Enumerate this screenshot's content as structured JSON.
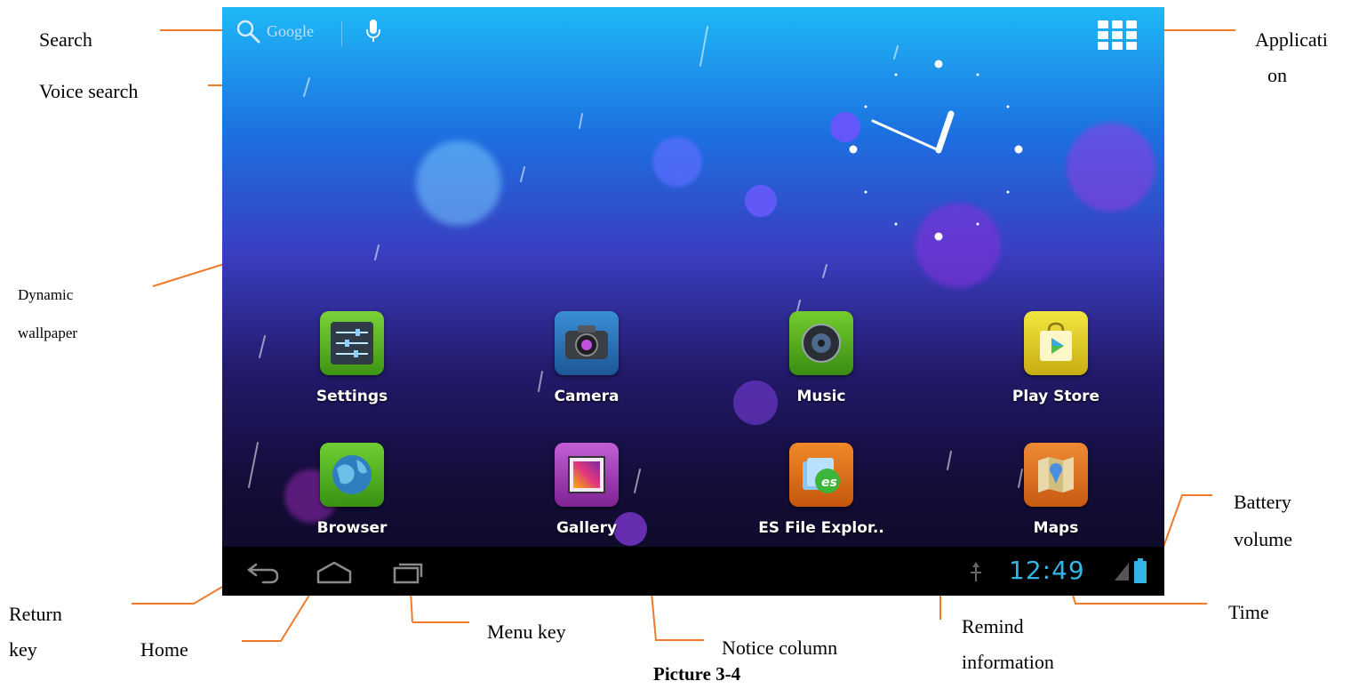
{
  "annotations": {
    "search": "Search",
    "voice_search": "Voice search",
    "application_line1": "Applicati",
    "application_line2": "on",
    "dynamic_wallpaper_line1": "Dynamic",
    "dynamic_wallpaper_line2": "wallpaper",
    "battery_line1": "Battery",
    "battery_line2": "volume",
    "return_line1": "Return",
    "return_line2": "key",
    "home": "Home",
    "menu_key": "Menu key",
    "notice_column": "Notice column",
    "remind_line1": "Remind",
    "remind_line2": "information",
    "time": "Time"
  },
  "screen": {
    "search_text": "Google",
    "status_time": "12:49",
    "apps_row1": [
      {
        "label": "Settings",
        "icon": "settings-icon"
      },
      {
        "label": "Camera",
        "icon": "camera-icon"
      },
      {
        "label": "Music",
        "icon": "music-icon"
      },
      {
        "label": "Play Store",
        "icon": "play-store-icon"
      }
    ],
    "apps_row2": [
      {
        "label": "Browser",
        "icon": "browser-icon"
      },
      {
        "label": "Gallery",
        "icon": "gallery-icon"
      },
      {
        "label": "ES File Explor..",
        "icon": "es-file-explorer-icon"
      },
      {
        "label": "Maps",
        "icon": "maps-icon"
      }
    ]
  },
  "caption": "Picture 3-4",
  "colors": {
    "annotation_line": "#f07a2a",
    "status_time": "#33b5e5",
    "navbar": "#000000"
  }
}
